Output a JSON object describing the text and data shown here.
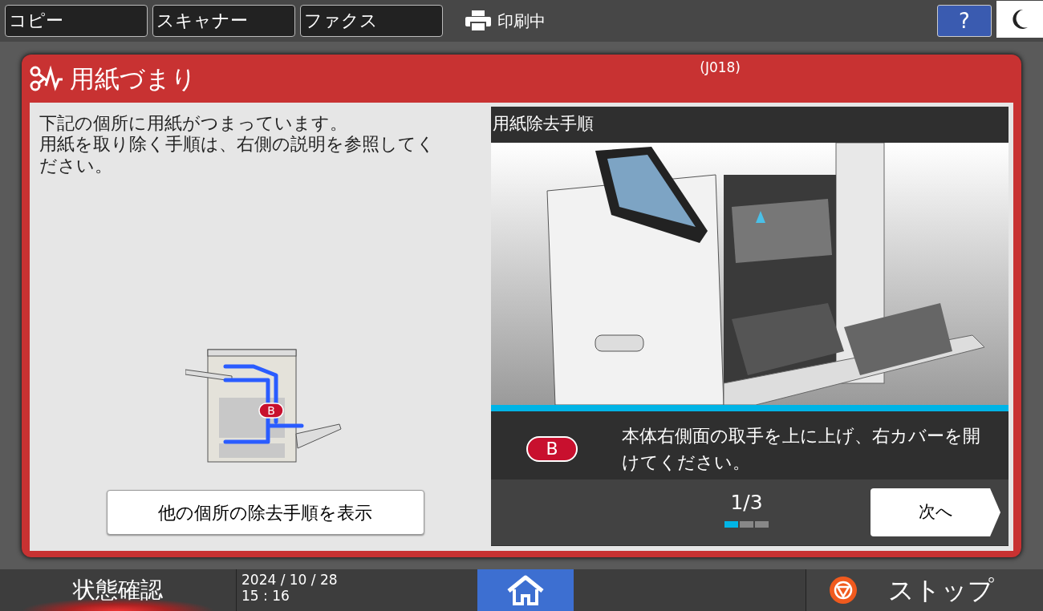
{
  "top_tabs": [
    {
      "label": "コピー"
    },
    {
      "label": "スキャナー"
    },
    {
      "label": "ファクス"
    }
  ],
  "print_status": "印刷中",
  "help_button": "?",
  "dialog": {
    "title": "用紙づまり",
    "code": "(J018)",
    "message": [
      "下記の個所に用紙がつまっています。",
      "用紙を取り除く手順は、右側の説明を参照してください。"
    ],
    "location_badge": "B",
    "other_button": "他の個所の除去手順を表示",
    "guide": {
      "header": "用紙除去手順",
      "step_badge": "B",
      "instruction": "本体右側面の取手を上に上げ、右カバーを開けてください。",
      "page": "1/3",
      "dots": [
        {
          "selected": true
        },
        {
          "selected": false
        },
        {
          "selected": false
        }
      ],
      "next_button": "次へ"
    }
  },
  "status_button": "状態確認",
  "date": "2024 / 10 / 28",
  "time": "15 : 16",
  "stop_button": "ストップ"
}
